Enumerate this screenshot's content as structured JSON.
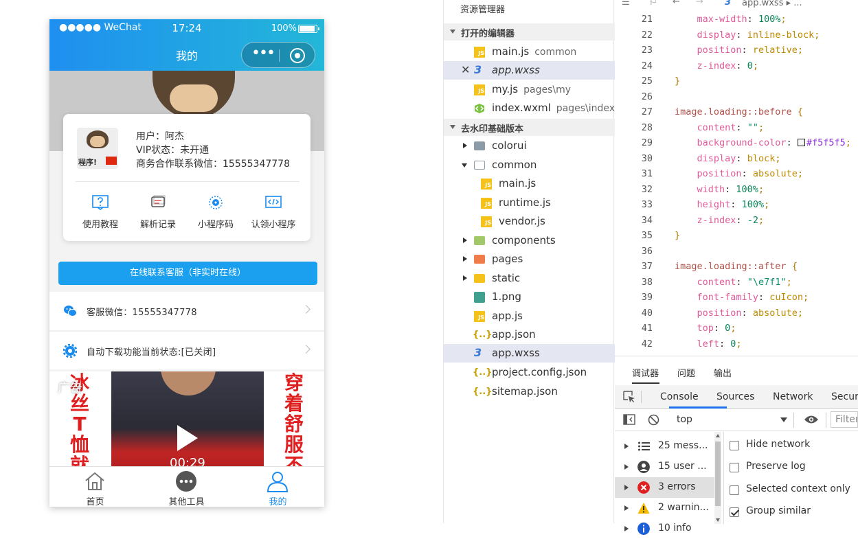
{
  "phone": {
    "status": {
      "carrier": "●●●●● WeChat",
      "time": "17:24",
      "battery": "100%"
    },
    "title": "我的",
    "capsule": {
      "more": "•••"
    },
    "user": {
      "avatar_text": "程序!",
      "username": "用户：阿杰",
      "vip": "VIP状态：未开通",
      "contact": "商务合作联系微信：15555347778"
    },
    "tools": [
      {
        "label": "使用教程",
        "icon": "help-icon"
      },
      {
        "label": "解析记录",
        "icon": "records-icon"
      },
      {
        "label": "小程序码",
        "icon": "qrcode-icon"
      },
      {
        "label": "认领小程序",
        "icon": "code-icon"
      }
    ],
    "contact_button": "在线联系客服（非实时在线）",
    "rows": [
      {
        "text": "客服微信：15555347778",
        "icon": "wechat-icon"
      },
      {
        "text": "自动下载功能当前状态:[已关闭]",
        "icon": "gear-icon"
      }
    ],
    "ad": {
      "label": "广告",
      "left_text": "冰丝T恤就",
      "right_text": "穿着舒服不",
      "duration": "00:29"
    },
    "tabs": [
      {
        "label": "首页",
        "icon": "home-icon"
      },
      {
        "label": "其他工具",
        "icon": "more-icon"
      },
      {
        "label": "我的",
        "icon": "user-icon"
      }
    ],
    "colors": {
      "accent": "#1ba0f0",
      "header_start": "#1f8ff0",
      "header_end": "#23b7d8",
      "active_tab": "#1a8cf0"
    }
  },
  "explorer": {
    "title": "资源管理器",
    "open_editors_title": "打开的编辑器",
    "open_editors": [
      {
        "name": "main.js",
        "desc": "common",
        "type": "js"
      },
      {
        "name": "app.wxss",
        "desc": "",
        "type": "wxss",
        "close": "✕"
      },
      {
        "name": "my.js",
        "desc": "pages\\my",
        "type": "js"
      },
      {
        "name": "index.wxml",
        "desc": "pages\\index",
        "type": "wxml"
      }
    ],
    "project_title": "去水印基础版本",
    "tree": [
      {
        "name": "colorui",
        "type": "folder"
      },
      {
        "name": "common",
        "type": "folder-open"
      },
      {
        "name": "main.js",
        "type": "js"
      },
      {
        "name": "runtime.js",
        "type": "js"
      },
      {
        "name": "vendor.js",
        "type": "js"
      },
      {
        "name": "components",
        "type": "folder"
      },
      {
        "name": "pages",
        "type": "folder"
      },
      {
        "name": "static",
        "type": "folder"
      },
      {
        "name": "1.png",
        "type": "png"
      },
      {
        "name": "app.js",
        "type": "js"
      },
      {
        "name": "app.json",
        "type": "json"
      },
      {
        "name": "app.wxss",
        "type": "wxss"
      },
      {
        "name": "project.config.json",
        "type": "json"
      },
      {
        "name": "sitemap.json",
        "type": "json"
      }
    ]
  },
  "editor": {
    "breadcrumb": "app.wxss ▸ ...",
    "lines": [
      {
        "n": "21",
        "t": "    max-width: 100%;"
      },
      {
        "n": "22",
        "t": "    display: inline-block;"
      },
      {
        "n": "23",
        "t": "    position: relative;"
      },
      {
        "n": "24",
        "t": "    z-index: 0;"
      },
      {
        "n": "25",
        "t": "}"
      },
      {
        "n": "26",
        "t": ""
      },
      {
        "n": "27",
        "t": "image.loading::before {"
      },
      {
        "n": "28",
        "t": "    content: \"\";"
      },
      {
        "n": "29",
        "t": "    background-color: #f5f5f5;"
      },
      {
        "n": "30",
        "t": "    display: block;"
      },
      {
        "n": "31",
        "t": "    position: absolute;"
      },
      {
        "n": "32",
        "t": "    width: 100%;"
      },
      {
        "n": "33",
        "t": "    height: 100%;"
      },
      {
        "n": "34",
        "t": "    z-index: -2;"
      },
      {
        "n": "35",
        "t": "}"
      },
      {
        "n": "36",
        "t": ""
      },
      {
        "n": "37",
        "t": "image.loading::after {"
      },
      {
        "n": "38",
        "t": "    content: \"\\e7f1\";"
      },
      {
        "n": "39",
        "t": "    font-family: cuIcon;"
      },
      {
        "n": "40",
        "t": "    position: absolute;"
      },
      {
        "n": "41",
        "t": "    top: 0;"
      },
      {
        "n": "42",
        "t": "    left: 0;"
      }
    ]
  },
  "devtools": {
    "top_tabs": [
      "调试器",
      "问题",
      "输出"
    ],
    "tabs": [
      "Console",
      "Sources",
      "Network",
      "Securi"
    ],
    "context": "top",
    "filter_placeholder": "Filter",
    "sidebar": [
      {
        "text": "25 mess...",
        "icon": "list-icon",
        "color": "#444"
      },
      {
        "text": "15 user ...",
        "icon": "user-icon",
        "color": "#444"
      },
      {
        "text": "3 errors",
        "icon": "error-icon",
        "color": "#e02020"
      },
      {
        "text": "2 warnin...",
        "icon": "warning-icon",
        "color": "#f5b800"
      },
      {
        "text": "10 info",
        "icon": "info-icon",
        "color": "#1a5ed8"
      }
    ],
    "options": [
      {
        "text": "Hide network",
        "checked": false
      },
      {
        "text": "Preserve log",
        "checked": false
      },
      {
        "text": "Selected context only",
        "checked": false
      },
      {
        "text": "Group similar",
        "checked": true
      }
    ]
  }
}
